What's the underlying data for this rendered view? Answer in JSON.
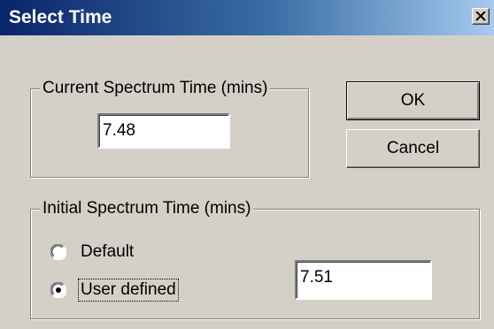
{
  "dialog": {
    "title": "Select Time",
    "close_icon": "close-x-icon"
  },
  "current_group": {
    "legend": "Current Spectrum Time (mins)",
    "value": "7.48"
  },
  "initial_group": {
    "legend": "Initial Spectrum Time (mins)",
    "options": [
      {
        "label": "Default",
        "selected": false
      },
      {
        "label": "User defined",
        "selected": true
      }
    ],
    "user_value": "7.51"
  },
  "buttons": {
    "ok_label": "OK",
    "cancel_label": "Cancel"
  }
}
